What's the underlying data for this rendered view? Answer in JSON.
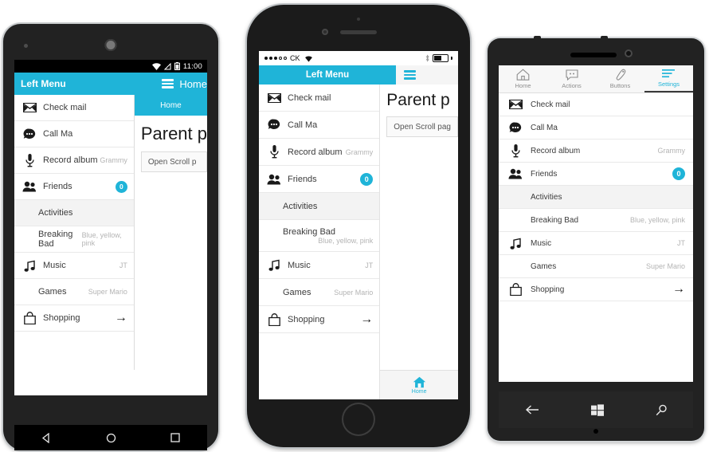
{
  "accent": "#1fb4d8",
  "menu": {
    "title": "Left Menu",
    "items": [
      {
        "icon": "mail-icon",
        "label": "Check mail",
        "sub": "",
        "type": "item"
      },
      {
        "icon": "chat-icon",
        "label": "Call Ma",
        "sub": "",
        "type": "item"
      },
      {
        "icon": "mic-icon",
        "label": "Record album",
        "sub": "Grammy",
        "type": "item"
      },
      {
        "icon": "friends-icon",
        "label": "Friends",
        "sub": "",
        "badge": "0",
        "type": "item"
      },
      {
        "icon": "",
        "label": "Activities",
        "sub": "",
        "type": "header"
      },
      {
        "icon": "",
        "label": "Breaking Bad",
        "sub": "Blue, yellow, pink",
        "type": "subitem"
      },
      {
        "icon": "music-icon",
        "label": "Music",
        "sub": "JT",
        "type": "item"
      },
      {
        "icon": "",
        "label": "Games",
        "sub": "Super Mario",
        "type": "subitem"
      },
      {
        "icon": "bag-icon",
        "label": "Shopping",
        "sub": "",
        "arrow": "→",
        "type": "item"
      }
    ]
  },
  "android": {
    "status": {
      "clock": "11:00",
      "wifi_icon": "wifi-icon",
      "signal_icon": "signal-icon",
      "battery_icon": "battery-icon"
    },
    "appbar": {
      "menu_icon": "hamburger-icon",
      "title": "Home"
    },
    "tabstrip": {
      "label": "Home"
    },
    "page": {
      "title": "Parent p",
      "button": "Open Scroll p"
    },
    "navbar": {
      "back": "◁",
      "home": "○",
      "recents": "□"
    }
  },
  "iphone": {
    "status": {
      "carrier": "CK",
      "wifi_icon": "wifi-icon",
      "bluetooth_icon": "bluetooth-icon",
      "battery_icon": "battery-icon"
    },
    "appbar": {
      "menu_icon": "hamburger-icon"
    },
    "page": {
      "title": "Parent p",
      "button": "Open Scroll pag"
    },
    "tabbar": [
      {
        "icon": "home-icon",
        "label": "Home"
      }
    ]
  },
  "winphone": {
    "tabs": [
      {
        "icon": "home-icon",
        "label": "Home",
        "active": false
      },
      {
        "icon": "actions-icon",
        "label": "Actions",
        "active": false
      },
      {
        "icon": "buttons-icon",
        "label": "Buttons",
        "active": false
      },
      {
        "icon": "settings-icon",
        "label": "Settings",
        "active": true
      }
    ],
    "navbar": {
      "back": "back-arrow-icon",
      "start": "windows-icon",
      "search": "search-icon"
    }
  }
}
